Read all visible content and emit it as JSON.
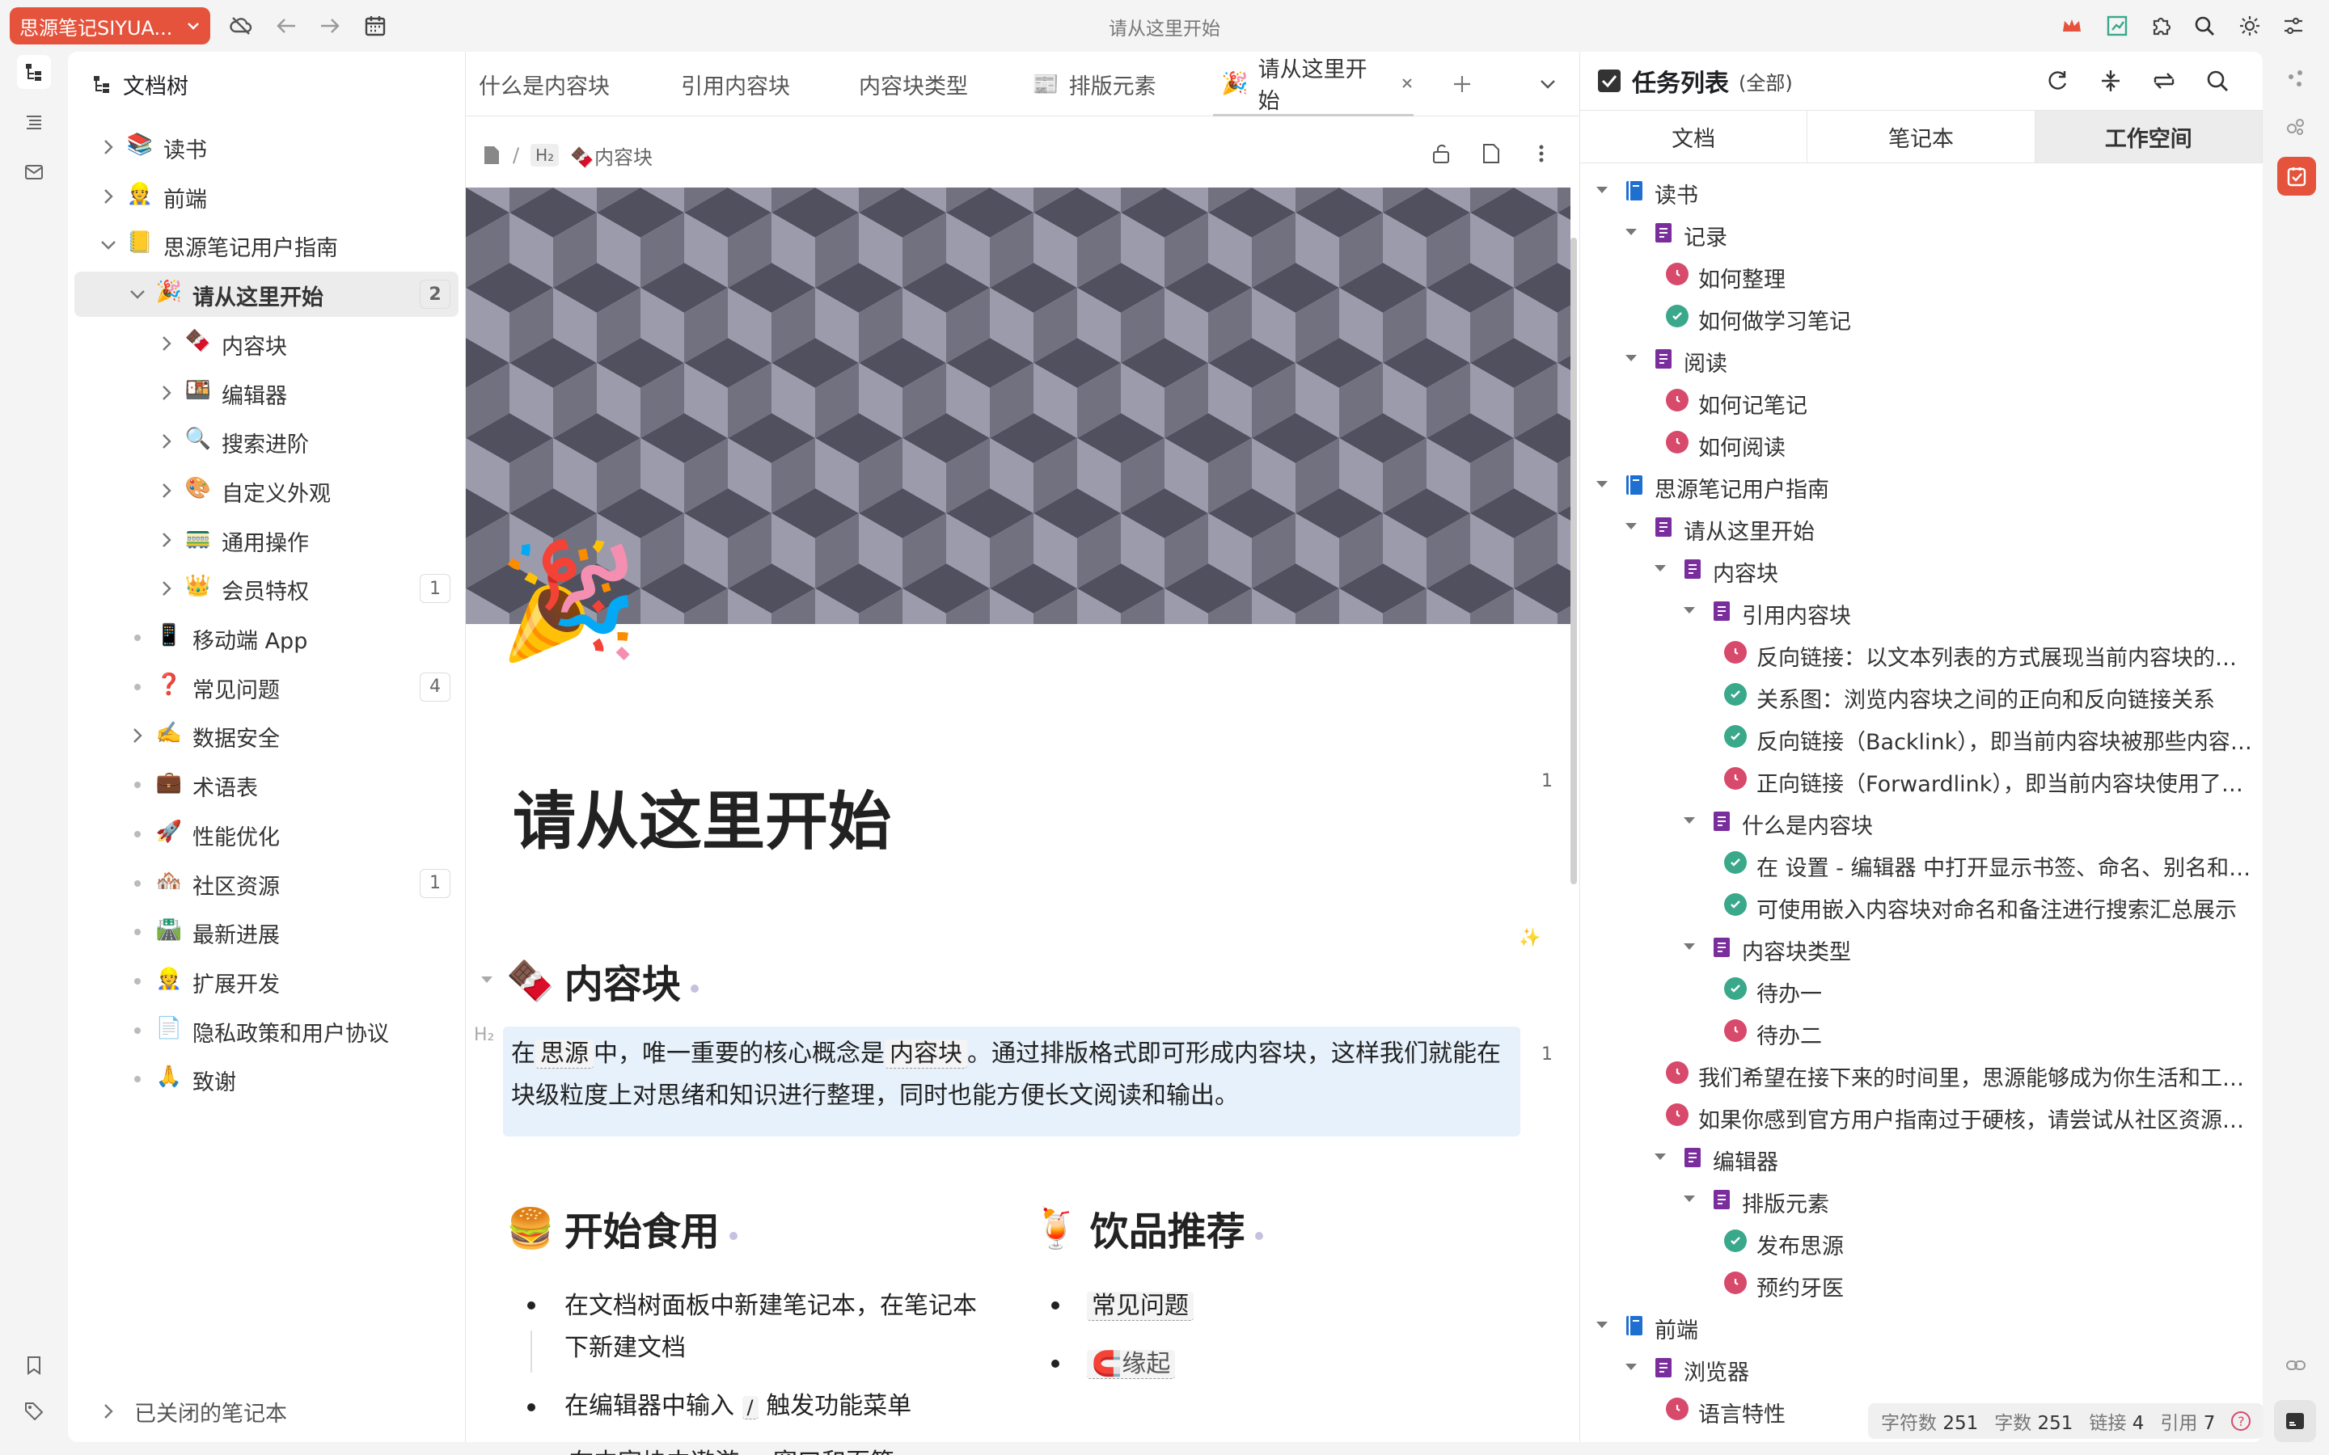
{
  "titlebar": {
    "workspace": "思源笔记SIYUA...",
    "title": "请从这里开始"
  },
  "tree": {
    "header": "文档树",
    "closed": "已关闭的笔记本",
    "items": [
      {
        "label": "读书",
        "emoji": "📚"
      },
      {
        "label": "前端",
        "emoji": "👷"
      },
      {
        "label": "思源笔记用户指南",
        "emoji": "📒"
      },
      {
        "label": "请从这里开始",
        "emoji": "🎉",
        "count": "2"
      },
      {
        "label": "内容块",
        "emoji": "🍫"
      },
      {
        "label": "编辑器",
        "emoji": "🍱"
      },
      {
        "label": "搜索进阶",
        "emoji": "🔍"
      },
      {
        "label": "自定义外观",
        "emoji": "🎨"
      },
      {
        "label": "通用操作",
        "emoji": "🚃"
      },
      {
        "label": "会员特权",
        "emoji": "👑",
        "count": "1"
      },
      {
        "label": "移动端 App",
        "emoji": "📱"
      },
      {
        "label": "常见问题",
        "emoji": "❓",
        "count": "4"
      },
      {
        "label": "数据安全",
        "emoji": "✍️"
      },
      {
        "label": "术语表",
        "emoji": "💼"
      },
      {
        "label": "性能优化",
        "emoji": "🚀"
      },
      {
        "label": "社区资源",
        "emoji": "🏘️",
        "count": "1"
      },
      {
        "label": "最新进展",
        "emoji": "🛣️"
      },
      {
        "label": "扩展开发",
        "emoji": "👷"
      },
      {
        "label": "隐私政策和用户协议",
        "emoji": "📄"
      },
      {
        "label": "致谢",
        "emoji": "🙏"
      }
    ]
  },
  "tabs": [
    {
      "label": "什么是内容块"
    },
    {
      "label": "引用内容块"
    },
    {
      "label": "内容块类型"
    },
    {
      "label": "排版元素",
      "emoji": "📰"
    },
    {
      "label": "请从这里开始",
      "emoji": "🎉"
    }
  ],
  "breadcrumb": {
    "heading_tag": "H₂",
    "current": "内容块",
    "emoji": "🍫"
  },
  "doc": {
    "icon": "🎉",
    "title": "请从这里开始",
    "h2_block": "内容块",
    "h2_block_emoji": "🍫",
    "block_count": "1",
    "para_count": "1",
    "heading_mark": "H₂",
    "para": {
      "p1": "在",
      "ref1": "思源",
      "p2": "中，唯一重要的核心概念是",
      "ref2": "内容块",
      "p3": "。通过排版格式即可形成内容块，这样我们就能在块级粒度上对思绪和知识进行整理，同时也能方便长文阅读和输出。"
    },
    "h2_start": "开始食用",
    "h2_start_emoji": "🍔",
    "h2_drink": "饮品推荐",
    "h2_drink_emoji": "🍹",
    "start_items": {
      "a1": "在文档树面板中新建笔记本，在笔记本",
      "a2": "下新建文档",
      "b1": "在编辑器中输入",
      "b_key": "/",
      "b2": "触发功能菜单",
      "c1": "在内容块中遨游",
      "c_sep": "、",
      "c2": "窗口和页签"
    },
    "drink_items": {
      "a": "常见问题",
      "b": "缘起",
      "b_emoji": "🧲"
    }
  },
  "tasks": {
    "title": "任务列表",
    "scope": "(全部)",
    "tabs": [
      "文档",
      "笔记本",
      "工作空间"
    ],
    "rows": [
      {
        "label": "读书"
      },
      {
        "label": "记录"
      },
      {
        "label": "如何整理"
      },
      {
        "label": "如何做学习笔记"
      },
      {
        "label": "阅读"
      },
      {
        "label": "如何记笔记"
      },
      {
        "label": "如何阅读"
      },
      {
        "label": "思源笔记用户指南"
      },
      {
        "label": "请从这里开始"
      },
      {
        "label": "内容块"
      },
      {
        "label": "引用内容块"
      },
      {
        "label": "反向链接：以文本列表的方式展现当前内容块的反向链接关系"
      },
      {
        "label": "关系图：浏览内容块之间的正向和反向链接关系"
      },
      {
        "label": "反向链接（Backlink），即当前内容块被那些内容块引用"
      },
      {
        "label": "正向链接（Forwardlink），即当前内容块使用了哪些引用"
      },
      {
        "label": "什么是内容块"
      },
      {
        "label": "在 设置 - 编辑器 中打开显示书签、命名、别名和备注"
      },
      {
        "label": "可使用嵌入内容块对命名和备注进行搜索汇总展示"
      },
      {
        "label": "内容块类型"
      },
      {
        "label": "待办一"
      },
      {
        "label": "待办二"
      },
      {
        "label": "我们希望在接下来的时间里，思源能够成为你生活和工作中的好帮手"
      },
      {
        "label": "如果你感到官方用户指南过于硬核，请尝试从社区资源中寻找"
      },
      {
        "label": "编辑器"
      },
      {
        "label": "排版元素"
      },
      {
        "label": "发布思源"
      },
      {
        "label": "预约牙医"
      },
      {
        "label": "前端"
      },
      {
        "label": "浏览器"
      },
      {
        "label": "语言特性"
      }
    ]
  },
  "status": {
    "chars_label": "字符数",
    "chars": "251",
    "words_label": "字数",
    "words": "251",
    "links_label": "链接",
    "links": "4",
    "refs_label": "引用",
    "refs": "7"
  },
  "colors": {
    "accent": "#e5533c",
    "done": "#3aa88a",
    "todo": "#d74a6b",
    "notebook": "#1f6fd1",
    "doc": "#7a2d9c"
  }
}
